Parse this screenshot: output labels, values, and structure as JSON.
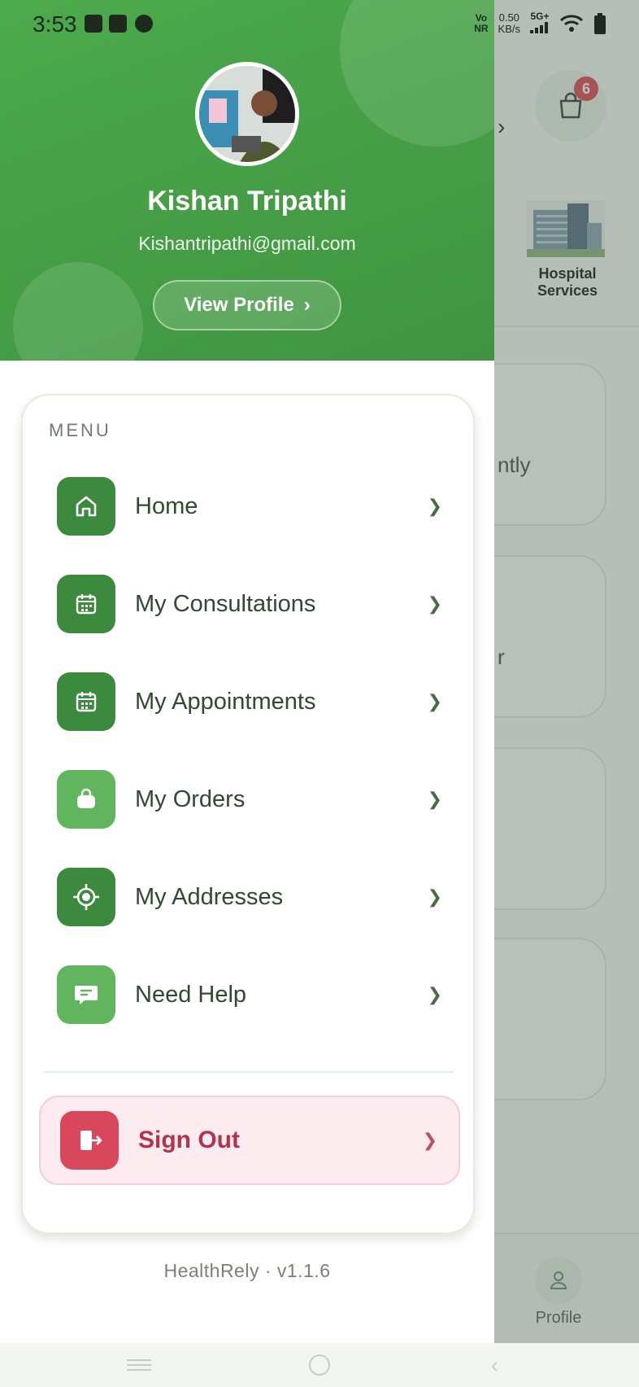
{
  "status_bar": {
    "time": "3:53",
    "network_top": "Vo",
    "network_bottom": "NR",
    "speed_value": "0.50",
    "speed_unit": "KB/s",
    "signal": "5G+"
  },
  "background": {
    "cart_count": "6",
    "hospital_label_line1": "Hospital",
    "hospital_label_line2": "Services",
    "card_text_1": "ntly",
    "card_text_2": "r",
    "bottom_nav_profile": "Profile"
  },
  "drawer": {
    "user_name": "Kishan Tripathi",
    "user_email": "Kishantripathi@gmail.com",
    "view_profile_label": "View Profile",
    "view_profile_chevron": "›",
    "menu_title": "MENU",
    "items": [
      {
        "label": "Home",
        "icon": "home-icon",
        "chevron": "❯"
      },
      {
        "label": "My Consultations",
        "icon": "calendar-icon",
        "chevron": "❯"
      },
      {
        "label": "My Appointments",
        "icon": "calendar-icon",
        "chevron": "❯"
      },
      {
        "label": "My Orders",
        "icon": "bag-icon",
        "chevron": "❯"
      },
      {
        "label": "My Addresses",
        "icon": "location-target-icon",
        "chevron": "❯"
      },
      {
        "label": "Need Help",
        "icon": "chat-icon",
        "chevron": "❯"
      }
    ],
    "sign_out_label": "Sign Out",
    "sign_out_chevron": "❯",
    "version_text": "HealthRely · v1.1.6"
  },
  "colors": {
    "header_green": "#4caa4c",
    "icon_dark_green": "#3c8a3d",
    "icon_light_green": "#62b55f",
    "sign_out_red": "#d9475d",
    "badge_red": "#e0404a"
  }
}
